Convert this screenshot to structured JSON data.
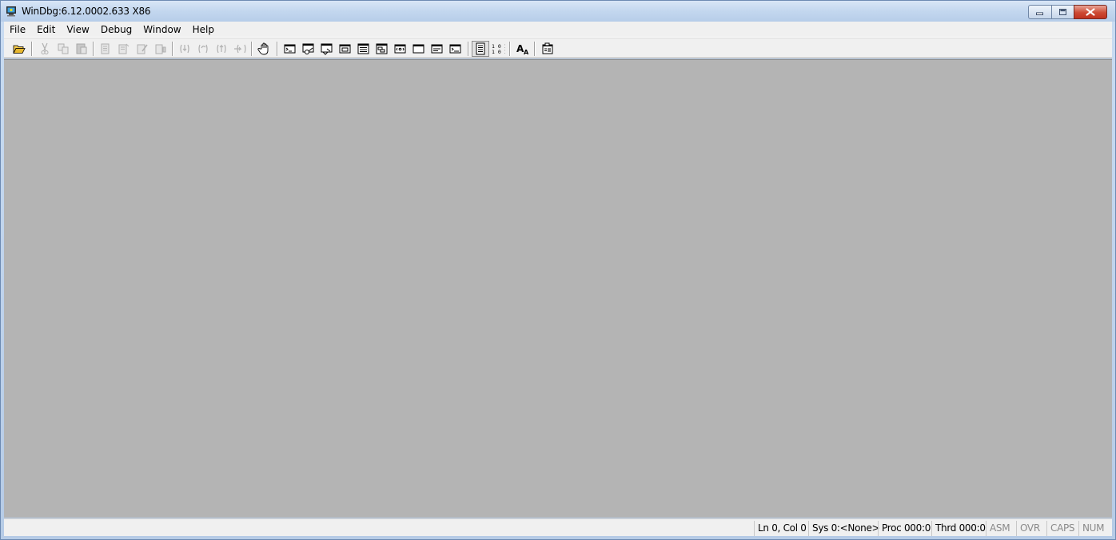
{
  "window": {
    "title": "WinDbg:6.12.0002.633 X86",
    "icon": "windbg-app-icon"
  },
  "caption_buttons": [
    "minimize",
    "restore",
    "close"
  ],
  "menu": [
    "File",
    "Edit",
    "View",
    "Debug",
    "Window",
    "Help"
  ],
  "toolbar": {
    "buttons": [
      {
        "icon": "open-folder-icon",
        "enabled": true
      },
      {
        "icon": "cut-icon",
        "enabled": false
      },
      {
        "icon": "copy-icon",
        "enabled": false
      },
      {
        "icon": "paste-icon",
        "enabled": false
      },
      {
        "icon": "go-icon",
        "enabled": false
      },
      {
        "icon": "restart-icon",
        "enabled": false
      },
      {
        "icon": "stop-debugging-icon",
        "enabled": false
      },
      {
        "icon": "detach-icon",
        "enabled": false
      },
      {
        "icon": "step-into-icon",
        "enabled": false
      },
      {
        "icon": "step-over-icon",
        "enabled": false
      },
      {
        "icon": "step-out-icon",
        "enabled": false
      },
      {
        "icon": "run-to-cursor-icon",
        "enabled": false
      },
      {
        "icon": "break-hand-icon",
        "enabled": true
      },
      {
        "icon": "command-window-icon",
        "enabled": true
      },
      {
        "icon": "watch-window-icon",
        "enabled": true
      },
      {
        "icon": "locals-window-icon",
        "enabled": true
      },
      {
        "icon": "registers-window-icon",
        "enabled": true
      },
      {
        "icon": "memory-window-icon",
        "enabled": true
      },
      {
        "icon": "call-stack-window-icon",
        "enabled": true
      },
      {
        "icon": "disassembly-window-icon",
        "enabled": true
      },
      {
        "icon": "scratch-pad-window-icon",
        "enabled": true
      },
      {
        "icon": "processes-threads-window-icon",
        "enabled": true
      },
      {
        "icon": "command-browser-window-icon",
        "enabled": true
      },
      {
        "icon": "source-mode-icon",
        "enabled": true,
        "pressed": true
      },
      {
        "icon": "binary-mode-icon",
        "enabled": true
      },
      {
        "icon": "font-icon",
        "enabled": true
      },
      {
        "icon": "options-icon",
        "enabled": true
      }
    ]
  },
  "statusbar": {
    "position": "Ln 0, Col 0",
    "system": "Sys 0:<None>",
    "process": "Proc 000:0",
    "thread": "Thrd 000:0",
    "asm": "ASM",
    "ovr": "OVR",
    "caps": "CAPS",
    "num": "NUM"
  },
  "colors": {
    "client_background": "#b4b4b4",
    "chrome_background": "#f0f0f0",
    "title_gradient_top": "#d8e6f6",
    "close_button": "#c0321f"
  }
}
